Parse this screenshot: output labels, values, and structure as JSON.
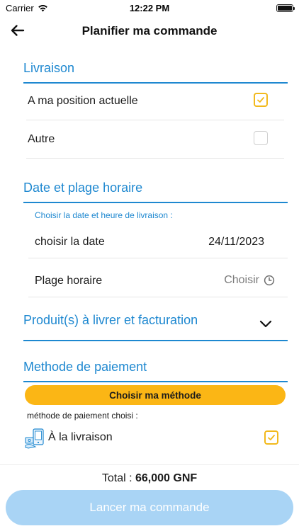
{
  "status_bar": {
    "carrier": "Carrier",
    "time": "12:22 PM"
  },
  "nav": {
    "title": "Planifier ma commande"
  },
  "delivery": {
    "title": "Livraison",
    "options": [
      {
        "label": "A ma position actuelle",
        "checked": true
      },
      {
        "label": "Autre",
        "checked": false
      }
    ]
  },
  "schedule": {
    "title": "Date et plage horaire",
    "hint": "Choisir la date et heure de livraison :",
    "date_label": "choisir la date",
    "date_value": "24/11/2023",
    "slot_label": "Plage horaire",
    "slot_value": "Choisir"
  },
  "products": {
    "title": "Produit(s) à livrer et facturation"
  },
  "payment": {
    "title": "Methode de paiement",
    "choose_button": "Choisir ma méthode",
    "chosen_hint": "méthode de paiement choisi :",
    "method": "À la livraison",
    "method_checked": true
  },
  "footer": {
    "total_label": "Total :",
    "total_value": "66,000 GNF",
    "submit": "Lancer ma commande"
  },
  "colors": {
    "accent": "#1e88d0",
    "button_yellow": "#fbb615",
    "check_yellow": "#f2b91c",
    "disabled_button": "#a9d4f5"
  }
}
